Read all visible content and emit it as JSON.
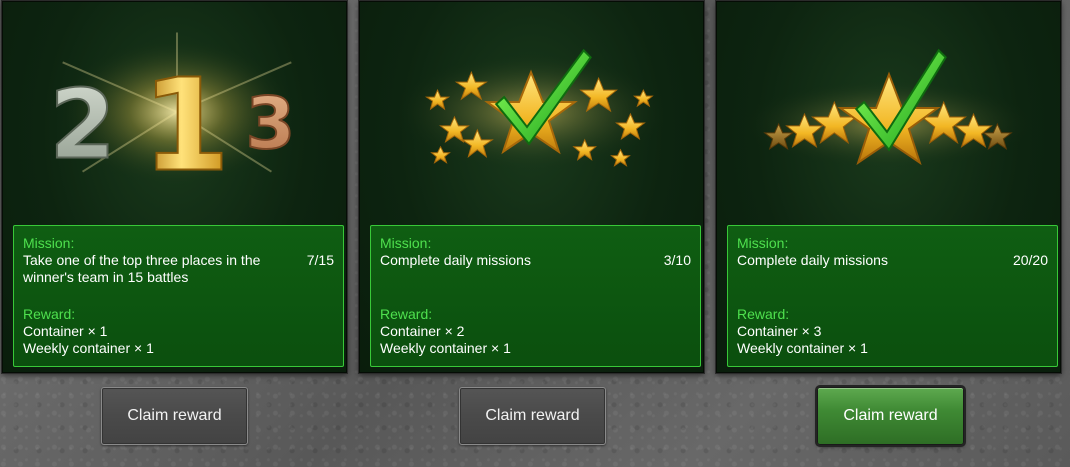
{
  "cards": [
    {
      "art_icon": "podium-1-2-3-icon",
      "mission_label": "Mission:",
      "mission_text": "Take one of the top three places in the winner's team in 15 battles",
      "progress": "7/15",
      "reward_label": "Reward:",
      "rewards": [
        "Container × 1",
        "Weekly container × 1"
      ],
      "button_label": "Claim reward",
      "button_active": false
    },
    {
      "art_icon": "star-burst-check-icon",
      "mission_label": "Mission:",
      "mission_text": "Complete daily missions",
      "progress": "3/10",
      "reward_label": "Reward:",
      "rewards": [
        "Container × 2",
        "Weekly container × 1"
      ],
      "button_label": "Claim reward",
      "button_active": false
    },
    {
      "art_icon": "star-row-check-icon",
      "mission_label": "Mission:",
      "mission_text": "Complete daily missions",
      "progress": "20/20",
      "reward_label": "Reward:",
      "rewards": [
        "Container × 3",
        "Weekly container × 1"
      ],
      "button_label": "Claim reward",
      "button_active": true
    }
  ],
  "art": {
    "digits": [
      "2",
      "1",
      "3"
    ]
  },
  "colors": {
    "card_bg": "#0d2410",
    "info_bg": "#0b4f0e",
    "info_border": "#38c838",
    "label_green": "#4ee04e",
    "star_gold": "#f2b623",
    "check_green": "#3fd62a",
    "active_button": "#3f8a34"
  }
}
